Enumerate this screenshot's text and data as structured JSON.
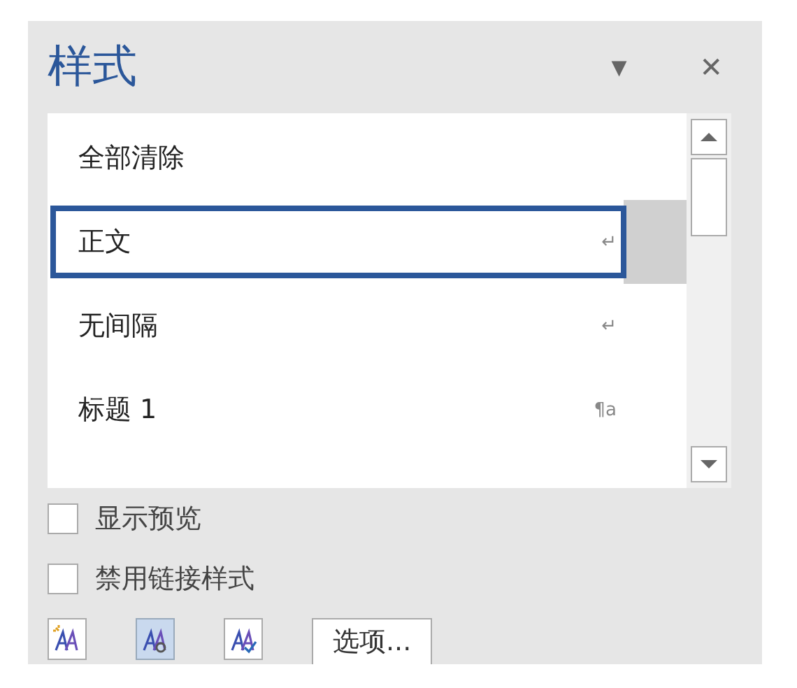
{
  "pane": {
    "title": "样式",
    "menu_glyph": "▾",
    "close_glyph": "✕"
  },
  "styles": [
    {
      "name": "全部清除",
      "selected": false
    },
    {
      "name": "正文",
      "selected": true,
      "mark": "↵"
    },
    {
      "name": "无间隔",
      "selected": false,
      "mark": "↵"
    },
    {
      "name": "标题 1",
      "selected": false,
      "mark": "¶a"
    }
  ],
  "options": [
    {
      "label": "显示预览",
      "checked": false
    },
    {
      "label": "禁用链接样式",
      "checked": false
    }
  ],
  "tools": [
    {
      "kind": "new",
      "selected": false
    },
    {
      "kind": "inspect",
      "selected": true
    },
    {
      "kind": "manage",
      "selected": false
    }
  ],
  "options_button": "选项..."
}
